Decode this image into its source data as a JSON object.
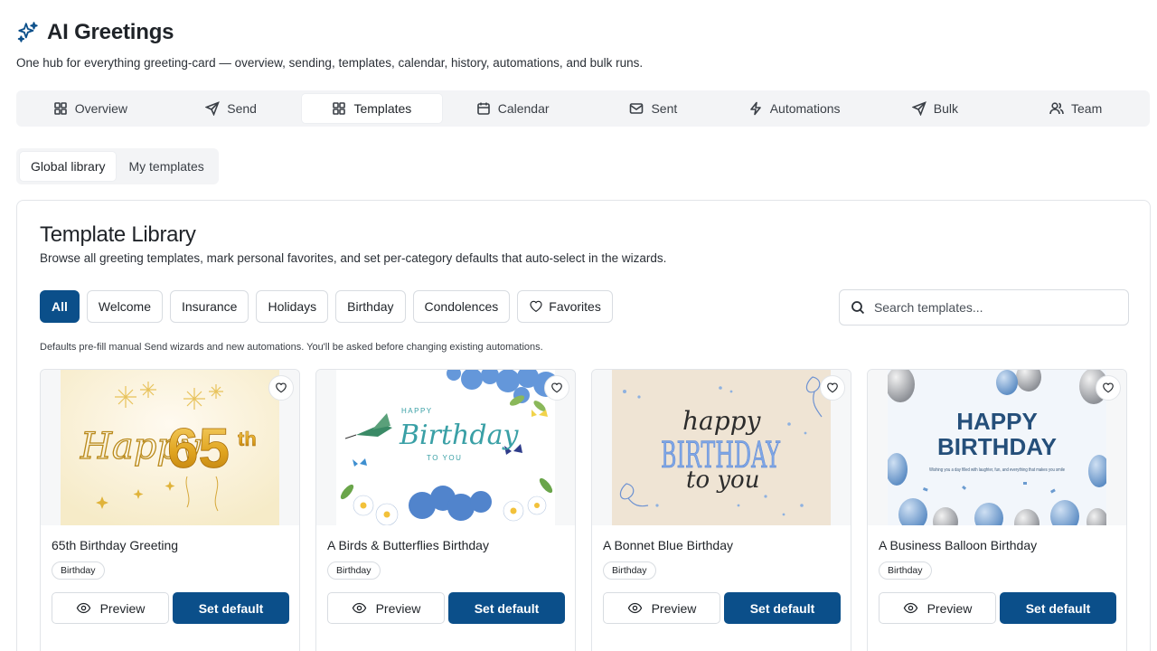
{
  "app": {
    "title": "AI Greetings",
    "subtitle": "One hub for everything greeting-card — overview, sending, templates, calendar, history, automations, and bulk runs.",
    "accent": "#0b4f8a"
  },
  "tabs": [
    {
      "label": "Overview",
      "icon": "grid-icon",
      "active": false
    },
    {
      "label": "Send",
      "icon": "send-icon",
      "active": false
    },
    {
      "label": "Templates",
      "icon": "grid-icon",
      "active": true
    },
    {
      "label": "Calendar",
      "icon": "calendar-icon",
      "active": false
    },
    {
      "label": "Sent",
      "icon": "mail-icon",
      "active": false
    },
    {
      "label": "Automations",
      "icon": "bolt-icon",
      "active": false
    },
    {
      "label": "Bulk",
      "icon": "send-icon",
      "active": false
    },
    {
      "label": "Team",
      "icon": "users-icon",
      "active": false
    }
  ],
  "subtabs": [
    {
      "label": "Global library",
      "active": true
    },
    {
      "label": "My templates",
      "active": false
    }
  ],
  "library": {
    "title": "Template Library",
    "description": "Browse all greeting templates, mark personal favorites, and set per-category defaults that auto-select in the wizards.",
    "filters": [
      "All",
      "Welcome",
      "Insurance",
      "Holidays",
      "Birthday",
      "Condolences",
      "Favorites"
    ],
    "search_placeholder": "Search templates...",
    "note": "Defaults pre-fill manual Send wizards and new automations. You'll be asked before changing existing automations."
  },
  "cards": [
    {
      "title": "65th Birthday Greeting",
      "category": "Birthday",
      "preview_label": "Preview",
      "default_label": "Set default",
      "art": {
        "line1": "Happy",
        "line2": "65",
        "line3": "th"
      }
    },
    {
      "title": "A Birds & Butterflies Birthday",
      "category": "Birthday",
      "preview_label": "Preview",
      "default_label": "Set default",
      "art": {
        "line1": "HAPPY",
        "line2": "Birthday",
        "line3": "TO YOU"
      }
    },
    {
      "title": "A Bonnet Blue Birthday",
      "category": "Birthday",
      "preview_label": "Preview",
      "default_label": "Set default",
      "art": {
        "line1": "happy",
        "line2": "BIRTHDAY",
        "line3": "to you"
      }
    },
    {
      "title": "A Business Balloon Birthday",
      "category": "Birthday",
      "preview_label": "Preview",
      "default_label": "Set default",
      "art": {
        "line1": "HAPPY",
        "line2": "BIRTHDAY",
        "line3": "Wishing you a day filled with laughter, fun, and everything that makes you smile"
      }
    }
  ]
}
